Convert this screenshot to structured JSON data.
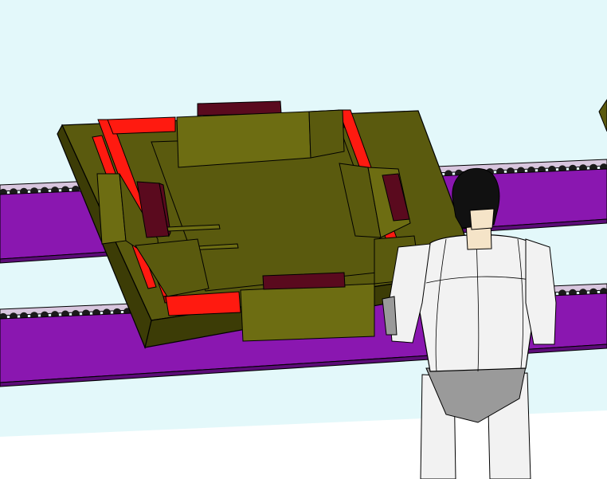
{
  "scene": {
    "colors": {
      "sky": "#e3f8fa",
      "floor": "#ffffff",
      "rail_purple": "#8a17b0",
      "rail_purple_dark": "#5c0c78",
      "rail_top": "#d8c6de",
      "roller_dark": "#1a1a1a",
      "pallet_olive": "#5a5a0e",
      "pallet_olive_light": "#6d6d12",
      "pallet_olive_dark": "#3c3c06",
      "fixture_red": "#ff1a10",
      "fixture_red_dark": "#a50c06",
      "block_maroon": "#5a0a1e",
      "figure_white": "#f2f2f2",
      "figure_grey": "#9a9a9a",
      "figure_hair": "#111111",
      "figure_skin": "#f5e4c8",
      "outline": "#000000"
    },
    "objects": [
      {
        "name": "conveyor-rail-back",
        "type": "roller-conveyor"
      },
      {
        "name": "conveyor-rail-front",
        "type": "roller-conveyor"
      },
      {
        "name": "work-pallet",
        "type": "fixture-plate"
      },
      {
        "name": "operator-figure",
        "type": "humanoid-model"
      }
    ]
  }
}
